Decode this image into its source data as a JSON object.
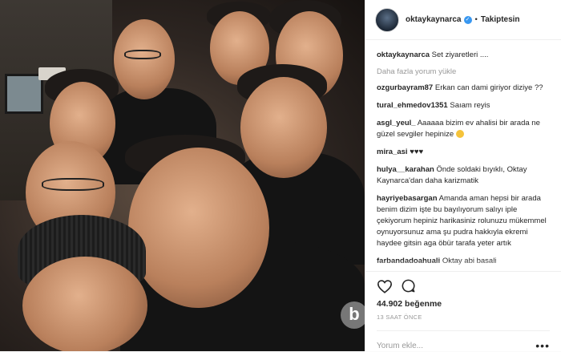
{
  "header": {
    "username": "oktaykaynarca",
    "verified_glyph": "✓",
    "separator": "•",
    "follow_status": "Takiptesin"
  },
  "caption": {
    "username": "oktaykaynarca",
    "text": "Set ziyaretleri ...."
  },
  "load_more": "Daha fazla yorum yükle",
  "comments": [
    {
      "username": "ozgurbayram87",
      "text": "Erkan can dami giriyor diziye ??"
    },
    {
      "username": "tural_ehmedov1351",
      "text": "Saıam reyis"
    },
    {
      "username": "asgl_yeul_",
      "text": "Aaaaaa bizim ev ahalisi bir arada ne güzel sevgiler hepinize"
    },
    {
      "username": "mira_asi",
      "text": "♥♥♥"
    },
    {
      "username": "hulya__karahan",
      "text": "Önde soldaki bıyıklı, Oktay Kaynarca'dan daha karizmatik"
    },
    {
      "username": "hayriyebasargan",
      "text": "Amanda aman hepsi bir arada benim dizim işte bu bayılıyorum salıyı iple çekiyorum hepiniz harikasiniz rolunuzu mükemmel oynuyorsunuz ama şu pudra hakkıyla ekremi haydee gitsin aga öbür tarafa yeter artık"
    },
    {
      "username": "farbandadoahuali",
      "text": "Oktay abi basali"
    }
  ],
  "actions": {
    "likes": "44.902 beğenme",
    "timestamp": "13 SAAT ÖNCE"
  },
  "add_comment": {
    "placeholder": "Yorum ekle...",
    "more_glyph": "•••"
  },
  "watermark_letter": "b"
}
